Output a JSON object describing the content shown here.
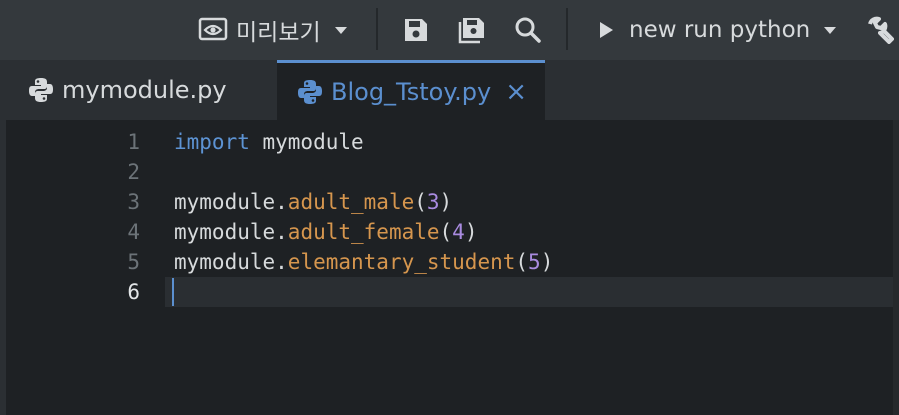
{
  "toolbar": {
    "preview_label": "미리보기",
    "run_label": "new run python",
    "icons": [
      "eye-icon",
      "save-icon",
      "save-all-icon",
      "search-icon",
      "play-icon",
      "wrench-icon"
    ]
  },
  "tabs": [
    {
      "label": "mymodule.py",
      "active": false
    },
    {
      "label": "Blog_Tstoy.py",
      "active": true,
      "close": "×"
    }
  ],
  "editor": {
    "lines": [
      {
        "number": "1",
        "tokens": [
          {
            "t": "import",
            "c": "kw"
          },
          {
            "t": " mymodule",
            "c": "id"
          }
        ]
      },
      {
        "number": "2",
        "tokens": []
      },
      {
        "number": "3",
        "tokens": [
          {
            "t": "mymodule.",
            "c": "id"
          },
          {
            "t": "adult_male",
            "c": "fn"
          },
          {
            "t": "(",
            "c": "id"
          },
          {
            "t": "3",
            "c": "num"
          },
          {
            "t": ")",
            "c": "id"
          }
        ]
      },
      {
        "number": "4",
        "tokens": [
          {
            "t": "mymodule.",
            "c": "id"
          },
          {
            "t": "adult_female",
            "c": "fn"
          },
          {
            "t": "(",
            "c": "id"
          },
          {
            "t": "4",
            "c": "num"
          },
          {
            "t": ")",
            "c": "id"
          }
        ]
      },
      {
        "number": "5",
        "tokens": [
          {
            "t": "mymodule.",
            "c": "id"
          },
          {
            "t": "elemantary_student",
            "c": "fn"
          },
          {
            "t": "(",
            "c": "id"
          },
          {
            "t": "5",
            "c": "num"
          },
          {
            "t": ")",
            "c": "id"
          }
        ]
      },
      {
        "number": "6",
        "tokens": [],
        "current": true
      }
    ]
  },
  "colors": {
    "keyword": "#5d93d3",
    "function": "#d6964e",
    "number": "#a98be0",
    "accent": "#5b8fcf"
  }
}
